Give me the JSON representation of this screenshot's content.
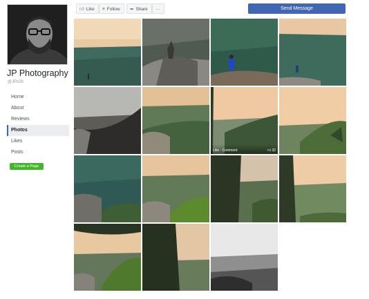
{
  "page": {
    "name": "JP Photography",
    "handle": "@JPx29"
  },
  "nav": {
    "items": [
      "Home",
      "About",
      "Reviews",
      "Photos",
      "Likes",
      "Posts"
    ],
    "active": "Photos"
  },
  "create_page_label": "Create a Page",
  "actions": {
    "like": "Like",
    "follow": "Follow",
    "share": "Share",
    "more": "···",
    "send_message": "Send Message"
  },
  "photo_hover": {
    "like_comment": "Like · Comment",
    "like_count": "32"
  },
  "icons": {
    "like": "thumbs-up-icon",
    "follow": "rss-icon",
    "share": "share-arrow-icon",
    "reaction": "thumbs-up-icon"
  },
  "colors": {
    "accent": "#4267b2",
    "create_button": "#42b72a",
    "active_nav_bg": "#ebedf0"
  }
}
